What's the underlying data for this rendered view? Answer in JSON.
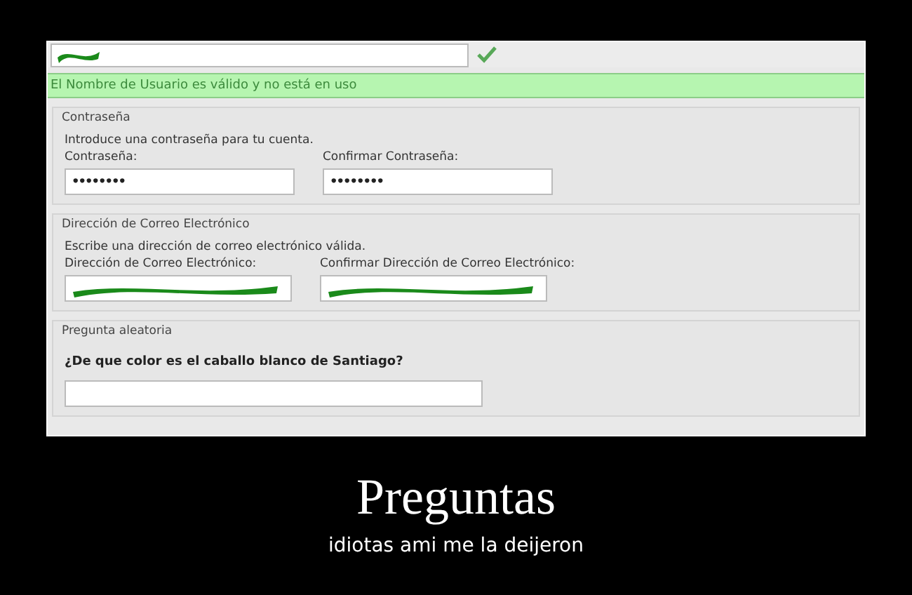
{
  "username": {
    "redacted": true,
    "valid": true
  },
  "message": "El Nombre de Usuario es válido y no está en uso",
  "sections": [
    {
      "legend": "Contraseña",
      "hint": "Introduce una contraseña para tu cuenta.",
      "fields": [
        {
          "label": "Contraseña:",
          "kind": "password",
          "value": "••••••••"
        },
        {
          "label": "Confirmar Contraseña:",
          "kind": "password",
          "value": "••••••••"
        }
      ]
    },
    {
      "legend": "Dirección de Correo Electrónico",
      "hint": "Escribe una dirección de correo electrónico válida.",
      "fields": [
        {
          "label": "Dirección de Correo Electrónico:",
          "kind": "redacted"
        },
        {
          "label": "Confirmar Dirección de Correo Electrónico:",
          "kind": "redacted"
        }
      ]
    },
    {
      "legend": "Pregunta aleatoria",
      "question": "¿De que color es el caballo blanco de Santiago?",
      "fields": [
        {
          "kind": "answer"
        }
      ]
    }
  ],
  "poster": {
    "title": "Preguntas",
    "caption": "idiotas ami me la deijeron"
  }
}
